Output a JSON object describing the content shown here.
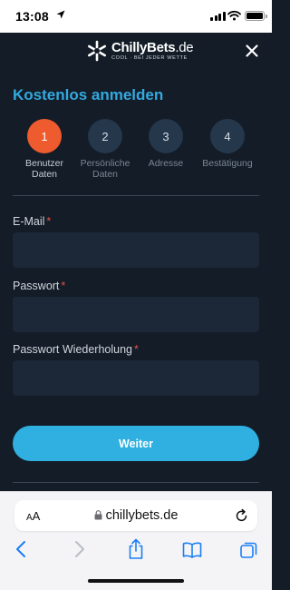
{
  "status_bar": {
    "time": "13:08"
  },
  "header": {
    "brand_main": "ChillyBets",
    "brand_tld": ".de",
    "tagline": "COOL · BEI JEDER WETTE"
  },
  "form": {
    "title": "Kostenlos anmelden",
    "steps": [
      {
        "number": "1",
        "label_line1": "Benutzer",
        "label_line2": "Daten"
      },
      {
        "number": "2",
        "label_line1": "Persönliche",
        "label_line2": "Daten"
      },
      {
        "number": "3",
        "label_line1": "Adresse",
        "label_line2": ""
      },
      {
        "number": "4",
        "label_line1": "Bestätigung",
        "label_line2": ""
      }
    ],
    "fields": [
      {
        "label": "E-Mail",
        "required_mark": "*",
        "value": ""
      },
      {
        "label": "Passwort",
        "required_mark": "*",
        "value": ""
      },
      {
        "label": "Passwort Wiederholung",
        "required_mark": "*",
        "value": ""
      }
    ],
    "submit_label": "Weiter"
  },
  "browser": {
    "aa_small": "A",
    "aa_large": "A",
    "url": "chillybets.de"
  },
  "colors": {
    "accent": "#33a9de",
    "active_step": "#ee5b2e",
    "background": "#131c27",
    "required": "#e2524a"
  }
}
